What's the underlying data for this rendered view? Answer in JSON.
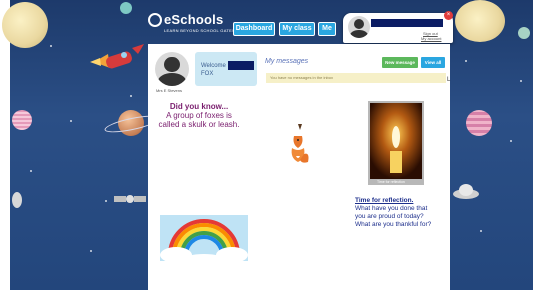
{
  "app": {
    "name": "eSchools",
    "tagline": "LEARN BEYOND SCHOOL GATES"
  },
  "nav": [
    {
      "label": "Dashboard"
    },
    {
      "label": "My class"
    },
    {
      "label": "Me"
    }
  ],
  "user_popup": {
    "link_1": "Sign out",
    "link_2": "My account"
  },
  "welcome": {
    "greeting": "Welcome",
    "user": "FOX",
    "avatar_caption": "Mrs E Stevens"
  },
  "messages": {
    "title": "My messages",
    "new_label": "New message",
    "view_all_label": "View all",
    "empty_text": "You have no messages in the inbox",
    "side_initial": "L"
  },
  "fact": {
    "heading": "Did you know...",
    "body": "A group of foxes is called a skulk or leash."
  },
  "reflection": {
    "heading": "Time for reflection.",
    "body": "What have you done that you are proud of today? What are you thankful for?"
  },
  "candle_caption": "Time for reflection",
  "colors": {
    "nav_button": "#2aa6e0",
    "new_message": "#5cb85c",
    "view_all": "#2aa6e0",
    "fact_text": "#7a1e6e",
    "reflection_text": "#1d2f8c",
    "redaction": "#0b1c64"
  }
}
